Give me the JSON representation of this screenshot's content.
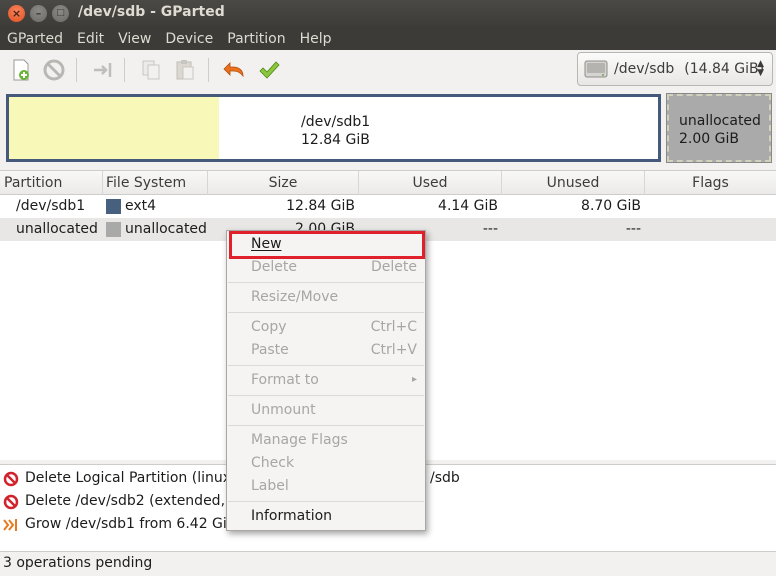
{
  "window": {
    "title": "/dev/sdb - GParted"
  },
  "menubar": [
    "GParted",
    "Edit",
    "View",
    "Device",
    "Partition",
    "Help"
  ],
  "toolbar": {
    "device": {
      "name": "/dev/sdb",
      "size": "(14.84 GiB)"
    }
  },
  "diskmap": {
    "sdb1": {
      "name": "/dev/sdb1",
      "size": "12.84 GiB"
    },
    "unallocated": {
      "name": "unallocated",
      "size": "2.00 GiB"
    }
  },
  "table": {
    "columns": [
      "Partition",
      "File System",
      "Size",
      "Used",
      "Unused",
      "Flags"
    ],
    "rows": [
      {
        "partition": "/dev/sdb1",
        "filesystem": "ext4",
        "fs_color": "#46607e",
        "size": "12.84 GiB",
        "used": "4.14 GiB",
        "unused": "8.70 GiB",
        "flags": ""
      },
      {
        "partition": "unallocated",
        "filesystem": "unallocated",
        "fs_color": "#a9a9a9",
        "size": "2.00 GiB",
        "used": "---",
        "unused": "---",
        "flags": ""
      }
    ]
  },
  "context_menu": {
    "new": "New",
    "delete": "Delete",
    "delete_accel": "Delete",
    "resize": "Resize/Move",
    "copy": "Copy",
    "copy_accel": "Ctrl+C",
    "paste": "Paste",
    "paste_accel": "Ctrl+V",
    "format": "Format to",
    "format_arrow": "▸",
    "unmount": "Unmount",
    "manage_flags": "Manage Flags",
    "check": "Check",
    "label": "Label",
    "information": "Information"
  },
  "operations": [
    "Delete Logical Partition (linux-",
    "Delete /dev/sdb2 (extended, 1",
    "Grow /dev/sdb1 from 6.42 GiB"
  ],
  "operations_tail": "/sdb",
  "status": "3 operations pending",
  "colors": {
    "accent_highlight": "#e0202a",
    "titlebar": "#3c3b37"
  }
}
